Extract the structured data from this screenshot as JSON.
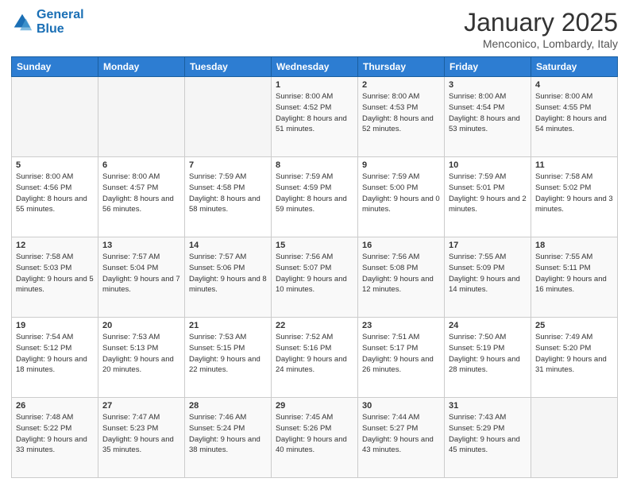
{
  "header": {
    "logo_line1": "General",
    "logo_line2": "Blue",
    "month_title": "January 2025",
    "location": "Menconico, Lombardy, Italy"
  },
  "weekdays": [
    "Sunday",
    "Monday",
    "Tuesday",
    "Wednesday",
    "Thursday",
    "Friday",
    "Saturday"
  ],
  "weeks": [
    [
      {
        "day": "",
        "info": ""
      },
      {
        "day": "",
        "info": ""
      },
      {
        "day": "",
        "info": ""
      },
      {
        "day": "1",
        "info": "Sunrise: 8:00 AM\nSunset: 4:52 PM\nDaylight: 8 hours\nand 51 minutes."
      },
      {
        "day": "2",
        "info": "Sunrise: 8:00 AM\nSunset: 4:53 PM\nDaylight: 8 hours\nand 52 minutes."
      },
      {
        "day": "3",
        "info": "Sunrise: 8:00 AM\nSunset: 4:54 PM\nDaylight: 8 hours\nand 53 minutes."
      },
      {
        "day": "4",
        "info": "Sunrise: 8:00 AM\nSunset: 4:55 PM\nDaylight: 8 hours\nand 54 minutes."
      }
    ],
    [
      {
        "day": "5",
        "info": "Sunrise: 8:00 AM\nSunset: 4:56 PM\nDaylight: 8 hours\nand 55 minutes."
      },
      {
        "day": "6",
        "info": "Sunrise: 8:00 AM\nSunset: 4:57 PM\nDaylight: 8 hours\nand 56 minutes."
      },
      {
        "day": "7",
        "info": "Sunrise: 7:59 AM\nSunset: 4:58 PM\nDaylight: 8 hours\nand 58 minutes."
      },
      {
        "day": "8",
        "info": "Sunrise: 7:59 AM\nSunset: 4:59 PM\nDaylight: 8 hours\nand 59 minutes."
      },
      {
        "day": "9",
        "info": "Sunrise: 7:59 AM\nSunset: 5:00 PM\nDaylight: 9 hours\nand 0 minutes."
      },
      {
        "day": "10",
        "info": "Sunrise: 7:59 AM\nSunset: 5:01 PM\nDaylight: 9 hours\nand 2 minutes."
      },
      {
        "day": "11",
        "info": "Sunrise: 7:58 AM\nSunset: 5:02 PM\nDaylight: 9 hours\nand 3 minutes."
      }
    ],
    [
      {
        "day": "12",
        "info": "Sunrise: 7:58 AM\nSunset: 5:03 PM\nDaylight: 9 hours\nand 5 minutes."
      },
      {
        "day": "13",
        "info": "Sunrise: 7:57 AM\nSunset: 5:04 PM\nDaylight: 9 hours\nand 7 minutes."
      },
      {
        "day": "14",
        "info": "Sunrise: 7:57 AM\nSunset: 5:06 PM\nDaylight: 9 hours\nand 8 minutes."
      },
      {
        "day": "15",
        "info": "Sunrise: 7:56 AM\nSunset: 5:07 PM\nDaylight: 9 hours\nand 10 minutes."
      },
      {
        "day": "16",
        "info": "Sunrise: 7:56 AM\nSunset: 5:08 PM\nDaylight: 9 hours\nand 12 minutes."
      },
      {
        "day": "17",
        "info": "Sunrise: 7:55 AM\nSunset: 5:09 PM\nDaylight: 9 hours\nand 14 minutes."
      },
      {
        "day": "18",
        "info": "Sunrise: 7:55 AM\nSunset: 5:11 PM\nDaylight: 9 hours\nand 16 minutes."
      }
    ],
    [
      {
        "day": "19",
        "info": "Sunrise: 7:54 AM\nSunset: 5:12 PM\nDaylight: 9 hours\nand 18 minutes."
      },
      {
        "day": "20",
        "info": "Sunrise: 7:53 AM\nSunset: 5:13 PM\nDaylight: 9 hours\nand 20 minutes."
      },
      {
        "day": "21",
        "info": "Sunrise: 7:53 AM\nSunset: 5:15 PM\nDaylight: 9 hours\nand 22 minutes."
      },
      {
        "day": "22",
        "info": "Sunrise: 7:52 AM\nSunset: 5:16 PM\nDaylight: 9 hours\nand 24 minutes."
      },
      {
        "day": "23",
        "info": "Sunrise: 7:51 AM\nSunset: 5:17 PM\nDaylight: 9 hours\nand 26 minutes."
      },
      {
        "day": "24",
        "info": "Sunrise: 7:50 AM\nSunset: 5:19 PM\nDaylight: 9 hours\nand 28 minutes."
      },
      {
        "day": "25",
        "info": "Sunrise: 7:49 AM\nSunset: 5:20 PM\nDaylight: 9 hours\nand 31 minutes."
      }
    ],
    [
      {
        "day": "26",
        "info": "Sunrise: 7:48 AM\nSunset: 5:22 PM\nDaylight: 9 hours\nand 33 minutes."
      },
      {
        "day": "27",
        "info": "Sunrise: 7:47 AM\nSunset: 5:23 PM\nDaylight: 9 hours\nand 35 minutes."
      },
      {
        "day": "28",
        "info": "Sunrise: 7:46 AM\nSunset: 5:24 PM\nDaylight: 9 hours\nand 38 minutes."
      },
      {
        "day": "29",
        "info": "Sunrise: 7:45 AM\nSunset: 5:26 PM\nDaylight: 9 hours\nand 40 minutes."
      },
      {
        "day": "30",
        "info": "Sunrise: 7:44 AM\nSunset: 5:27 PM\nDaylight: 9 hours\nand 43 minutes."
      },
      {
        "day": "31",
        "info": "Sunrise: 7:43 AM\nSunset: 5:29 PM\nDaylight: 9 hours\nand 45 minutes."
      },
      {
        "day": "",
        "info": ""
      }
    ]
  ]
}
